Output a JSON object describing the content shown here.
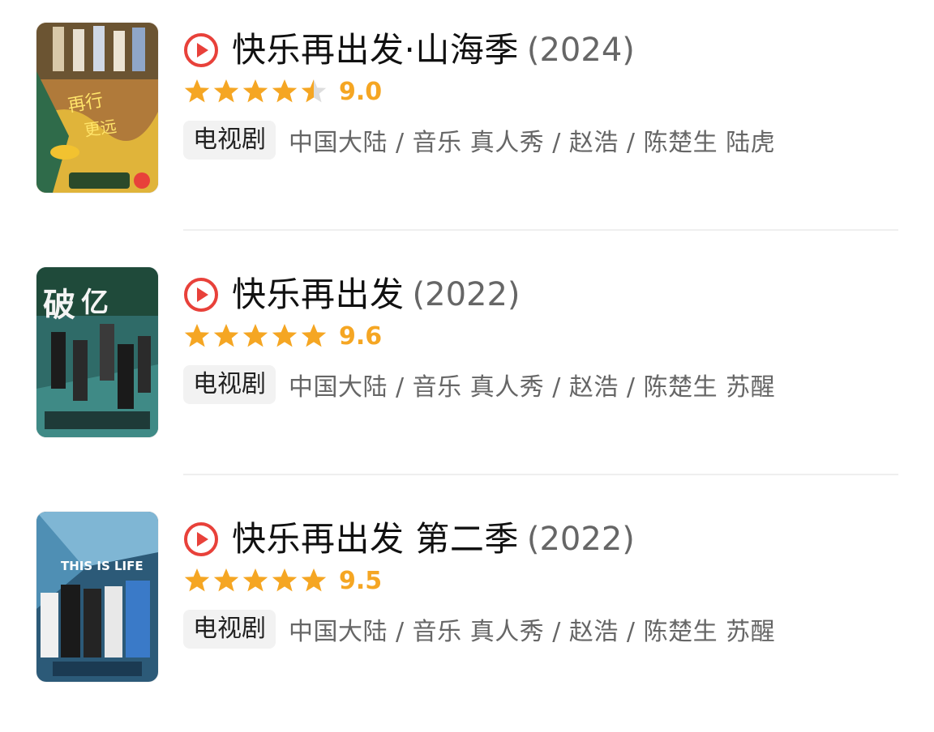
{
  "icons": {
    "play": "play-circle-icon",
    "star": "star-icon",
    "half_star": "half-star-icon"
  },
  "colors": {
    "accent_play": "#e8413a",
    "star": "#f5a623",
    "star_empty": "#dddddd"
  },
  "items": [
    {
      "title": "快乐再出发·山海季",
      "year": "(2024)",
      "rating_stars": 4.5,
      "score": "9.0",
      "type": "电视剧",
      "meta": "中国大陆 / 音乐 真人秀 / 赵浩 / 陈楚生 陆虎"
    },
    {
      "title": "快乐再出发",
      "year": "(2022)",
      "rating_stars": 5,
      "score": "9.6",
      "type": "电视剧",
      "meta": "中国大陆 / 音乐 真人秀 / 赵浩 / 陈楚生 苏醒"
    },
    {
      "title": "快乐再出发 第二季",
      "year": "(2022)",
      "rating_stars": 5,
      "score": "9.5",
      "type": "电视剧",
      "meta": "中国大陆 / 音乐 真人秀 / 赵浩 / 陈楚生 苏醒"
    }
  ]
}
